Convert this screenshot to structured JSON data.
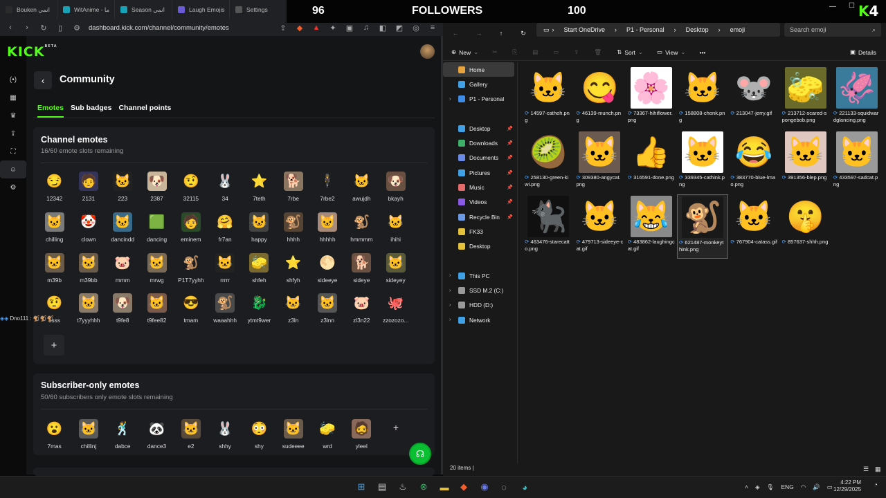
{
  "browser": {
    "tabs": [
      {
        "label": "Bouken انمي",
        "color": "#2b2b2b"
      },
      {
        "label": "WitAnime - ما",
        "color": "#17a2b8"
      },
      {
        "label": "Season انمي",
        "color": "#17a2b8"
      },
      {
        "label": "Laugh Emojis",
        "color": "#6b5bd6"
      },
      {
        "label": "Settings",
        "color": "#555555"
      }
    ],
    "url": "dashboard.kick.com/channel/community/emotes"
  },
  "stream_overlay": {
    "left_value": "96",
    "label": "FOLLOWERS",
    "right_value": "100",
    "badge": "K",
    "badge_num": "4"
  },
  "kick": {
    "logo": "KICK",
    "logo_sup": "BETA",
    "page_title": "Community",
    "subtabs": [
      "Emotes",
      "Sub badges",
      "Channel points"
    ],
    "channel_emotes": {
      "title": "Channel emotes",
      "subtitle": "16/60 emote slots remaining",
      "emotes": [
        {
          "label": "12342",
          "icon": "😏",
          "bg": "#1c1d21"
        },
        {
          "label": "2131",
          "icon": "🧑",
          "bg": "#34345a"
        },
        {
          "label": "223",
          "icon": "🐱",
          "bg": "#222222"
        },
        {
          "label": "2387",
          "icon": "🐶",
          "bg": "#c9b69a"
        },
        {
          "label": "32115",
          "icon": "🤨",
          "bg": "#1c1d21"
        },
        {
          "label": "34",
          "icon": "🐰",
          "bg": "#1c1d21"
        },
        {
          "label": "7teth",
          "icon": "⭐",
          "bg": "#1c1d21"
        },
        {
          "label": "7rbe",
          "icon": "🐕",
          "bg": "#8a7560"
        },
        {
          "label": "7rbe2",
          "icon": "🕴",
          "bg": "#1c1d21"
        },
        {
          "label": "awujdh",
          "icon": "🐱",
          "bg": "#1c1d21"
        },
        {
          "label": "bkayh",
          "icon": "🐶",
          "bg": "#6a5040"
        },
        {
          "label": "chilling",
          "icon": "🐱",
          "bg": "#7a7a7a"
        },
        {
          "label": "clown",
          "icon": "🤡",
          "bg": "#1c1d21"
        },
        {
          "label": "dancindd",
          "icon": "🐱",
          "bg": "#3a6a8a"
        },
        {
          "label": "dancing",
          "icon": "🟩",
          "bg": "#1c1d21"
        },
        {
          "label": "eminem",
          "icon": "🧑",
          "bg": "#2a4a2a"
        },
        {
          "label": "fr7an",
          "icon": "🤗",
          "bg": "#1c1d21"
        },
        {
          "label": "happy",
          "icon": "🐱",
          "bg": "#444444"
        },
        {
          "label": "hhhh",
          "icon": "🐒",
          "bg": "#554433"
        },
        {
          "label": "hhhhh",
          "icon": "🐱",
          "bg": "#a88a7a"
        },
        {
          "label": "hmmmm",
          "icon": "🐒",
          "bg": "#1c1d21"
        },
        {
          "label": "ihihi",
          "icon": "🐱",
          "bg": "#1c1d21"
        },
        {
          "label": "m39b",
          "icon": "🐱",
          "bg": "#6a5a4a"
        },
        {
          "label": "m39bb",
          "icon": "🐱",
          "bg": "#6a5a4a"
        },
        {
          "label": "mmm",
          "icon": "🐷",
          "bg": "#1c1d21"
        },
        {
          "label": "mrwg",
          "icon": "🐱",
          "bg": "#7a6a55"
        },
        {
          "label": "P1T7yyhh",
          "icon": "🐒",
          "bg": "#1c1d21"
        },
        {
          "label": "rrrrr",
          "icon": "🐱",
          "bg": "#222222"
        },
        {
          "label": "shfeh",
          "icon": "🧽",
          "bg": "#7a6a30"
        },
        {
          "label": "shfyh",
          "icon": "⭐",
          "bg": "#1c1d21"
        },
        {
          "label": "sideeye",
          "icon": "🌕",
          "bg": "#1c1d21"
        },
        {
          "label": "sideye",
          "icon": "🐕",
          "bg": "#6a5040"
        },
        {
          "label": "sideyey",
          "icon": "🐱",
          "bg": "#5a5a3a"
        },
        {
          "label": "ssss",
          "icon": "🤨",
          "bg": "#1c1d21"
        },
        {
          "label": "t7yyyhhh",
          "icon": "🐱",
          "bg": "#8a7a6a"
        },
        {
          "label": "t9fe8",
          "icon": "🐶",
          "bg": "#8a7a6a"
        },
        {
          "label": "t9fee82",
          "icon": "🐱",
          "bg": "#7a5a4a"
        },
        {
          "label": "tmam",
          "icon": "😎",
          "bg": "#1c1d21"
        },
        {
          "label": "waaahhh",
          "icon": "🐒",
          "bg": "#4a4a4a"
        },
        {
          "label": "ytmt9wer",
          "icon": "🐉",
          "bg": "#1c1d21"
        },
        {
          "label": "z3ln",
          "icon": "🐱",
          "bg": "#1c1d21"
        },
        {
          "label": "z3lnn",
          "icon": "🐱",
          "bg": "#555555"
        },
        {
          "label": "zl3n22",
          "icon": "🐷",
          "bg": "#1c1d21"
        },
        {
          "label": "zzozozo...",
          "icon": "🐙",
          "bg": "#1c1d21"
        }
      ]
    },
    "subscriber_emotes": {
      "title": "Subscriber-only emotes",
      "subtitle": "50/60 subscribers only emote slots remaining",
      "emotes": [
        {
          "label": "7mas",
          "icon": "😮",
          "bg": "#1c1d21"
        },
        {
          "label": "chillinj",
          "icon": "🐱",
          "bg": "#5a5a5a"
        },
        {
          "label": "dabce",
          "icon": "🕺",
          "bg": "#1c1d21"
        },
        {
          "label": "dance3",
          "icon": "🐼",
          "bg": "#1c1d21"
        },
        {
          "label": "e2",
          "icon": "🐱",
          "bg": "#5a4a3a"
        },
        {
          "label": "shhy",
          "icon": "🐰",
          "bg": "#1c1d21"
        },
        {
          "label": "shy",
          "icon": "😳",
          "bg": "#1c1d21"
        },
        {
          "label": "sudeeee",
          "icon": "🐱",
          "bg": "#6a5a4a"
        },
        {
          "label": "wrd",
          "icon": "🧽",
          "bg": "#1c1d21"
        },
        {
          "label": "yleel",
          "icon": "🧔",
          "bg": "#8a6a5a"
        }
      ]
    },
    "chat_user": "Dno111 :"
  },
  "explorer": {
    "breadcrumbs": [
      "Start OneDrive",
      "P1 - Personal",
      "Desktop",
      "emoji"
    ],
    "search_placeholder": "Search emoji",
    "toolbar": {
      "new": "New",
      "sort": "Sort",
      "view": "View",
      "details": "Details"
    },
    "nav": [
      {
        "label": "Home",
        "icon": "#e6a23c",
        "sel": true,
        "pin": false,
        "chev": false
      },
      {
        "label": "Gallery",
        "icon": "#3fa0e6",
        "sel": false,
        "pin": false,
        "chev": false
      },
      {
        "label": "P1 - Personal",
        "icon": "#3f8ce6",
        "sel": false,
        "pin": false,
        "chev": true
      },
      {
        "label": "",
        "icon": "",
        "sel": false,
        "pin": false,
        "chev": false
      },
      {
        "label": "Desktop",
        "icon": "#3fa0e6",
        "sel": false,
        "pin": true,
        "chev": false
      },
      {
        "label": "Downloads",
        "icon": "#3fb06a",
        "sel": false,
        "pin": true,
        "chev": false
      },
      {
        "label": "Documents",
        "icon": "#6a8ae6",
        "sel": false,
        "pin": true,
        "chev": false
      },
      {
        "label": "Pictures",
        "icon": "#3fa0e6",
        "sel": false,
        "pin": true,
        "chev": false
      },
      {
        "label": "Music",
        "icon": "#e66a6a",
        "sel": false,
        "pin": true,
        "chev": false
      },
      {
        "label": "Videos",
        "icon": "#8a5ae6",
        "sel": false,
        "pin": true,
        "chev": false
      },
      {
        "label": "Recycle Bin",
        "icon": "#6a9ae6",
        "sel": false,
        "pin": true,
        "chev": false
      },
      {
        "label": "FK33",
        "icon": "#e6c23c",
        "sel": false,
        "pin": false,
        "chev": false
      },
      {
        "label": "Desktop",
        "icon": "#e6c23c",
        "sel": false,
        "pin": false,
        "chev": false
      },
      {
        "label": "",
        "icon": "",
        "sel": false,
        "pin": false,
        "chev": false
      },
      {
        "label": "This PC",
        "icon": "#3fa0e6",
        "sel": false,
        "pin": false,
        "chev": true
      },
      {
        "label": "SSD M.2 (C:)",
        "icon": "#999999",
        "sel": false,
        "pin": false,
        "chev": true
      },
      {
        "label": "HDD (D:)",
        "icon": "#999999",
        "sel": false,
        "pin": false,
        "chev": true
      },
      {
        "label": "Network",
        "icon": "#3fa0e6",
        "sel": false,
        "pin": false,
        "chev": true
      }
    ],
    "files": [
      {
        "name": "14597-catheh.png",
        "icon": "🐱",
        "bg": "#191919",
        "sel": false
      },
      {
        "name": "46139-munch.png",
        "icon": "😋",
        "bg": "#191919",
        "sel": false
      },
      {
        "name": "73367-hihiflower.png",
        "icon": "🌸",
        "bg": "#ffffff",
        "sel": false
      },
      {
        "name": "158808-chonk.png",
        "icon": "🐱",
        "bg": "#191919",
        "sel": false
      },
      {
        "name": "213047-jerry.gif",
        "icon": "🐭",
        "bg": "#191919",
        "sel": false
      },
      {
        "name": "213712-scared-spongebob.png",
        "icon": "🧽",
        "bg": "#6a6a2a",
        "sel": false
      },
      {
        "name": "221133-squidwardglancing.png",
        "icon": "🦑",
        "bg": "#3a7a9a",
        "sel": false
      },
      {
        "name": "258130-green-kiwi.png",
        "icon": "🥝",
        "bg": "#191919",
        "sel": false
      },
      {
        "name": "309380-angycat.png",
        "icon": "🐱",
        "bg": "#6a5a50",
        "sel": false
      },
      {
        "name": "316591-done.png",
        "icon": "👍",
        "bg": "#191919",
        "sel": false
      },
      {
        "name": "339345-cathink.png",
        "icon": "🐱",
        "bg": "#ffffff",
        "sel": false
      },
      {
        "name": "383770-blue-lmao.png",
        "icon": "😂",
        "bg": "#191919",
        "sel": false
      },
      {
        "name": "391356-blep.png",
        "icon": "🐱",
        "bg": "#e0c8c0",
        "sel": false
      },
      {
        "name": "433597-sadcat.png",
        "icon": "🐱",
        "bg": "#9a9a9a",
        "sel": false
      },
      {
        "name": "463476-starecatto.png",
        "icon": "🐈‍⬛",
        "bg": "#101010",
        "sel": false
      },
      {
        "name": "479713-sideeye-cat.gif",
        "icon": "🐱",
        "bg": "#191919",
        "sel": false
      },
      {
        "name": "483862-laughingcat.gif",
        "icon": "😹",
        "bg": "#8a8a8a",
        "sel": false
      },
      {
        "name": "621487-monkeythink.png",
        "icon": "🐒",
        "bg": "#191919",
        "sel": true
      },
      {
        "name": "767904-catass.gif",
        "icon": "🐱",
        "bg": "#191919",
        "sel": false
      },
      {
        "name": "857637-shhh.png",
        "icon": "🤫",
        "bg": "#191919",
        "sel": false
      }
    ],
    "status": "20 items"
  },
  "taskbar": {
    "lang": "ENG",
    "time": "4:22 PM",
    "date": "12/29/2025"
  }
}
